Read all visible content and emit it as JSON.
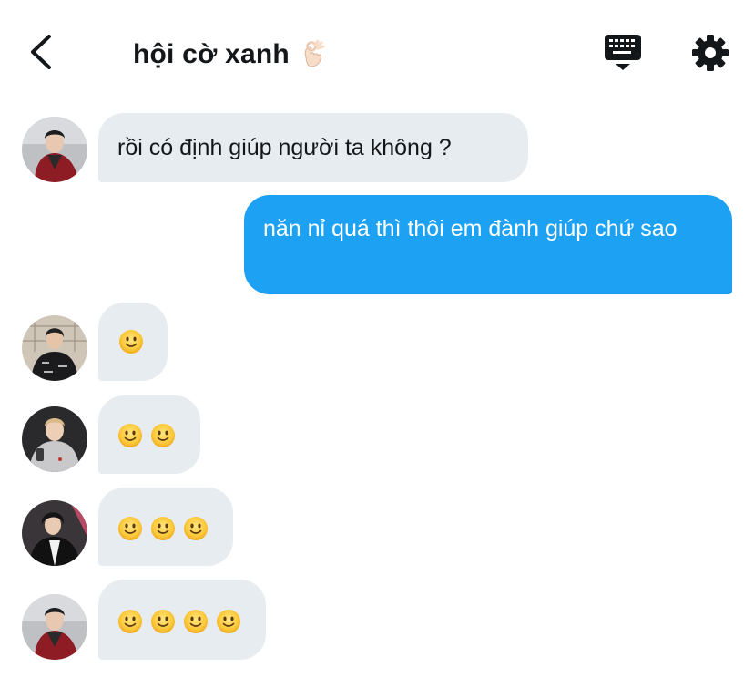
{
  "header": {
    "title": "hội cờ xanh",
    "title_emoji": "ok-hand-emoji",
    "back_icon": "chevron-left-icon",
    "keyboard_icon": "keyboard-icon",
    "settings_icon": "gear-icon"
  },
  "messages": [
    {
      "direction": "incoming",
      "text": "rồi có định giúp người ta không ?",
      "avatar": "avatar-red-jacket"
    },
    {
      "direction": "outgoing",
      "text": "năn nỉ quá thì thôi em đành giúp chứ sao"
    },
    {
      "direction": "incoming",
      "emoji_count": 1,
      "emoji": "slightly-smiling-face",
      "avatar": "avatar-black-jacket"
    },
    {
      "direction": "incoming",
      "emoji_count": 2,
      "emoji": "slightly-smiling-face",
      "avatar": "avatar-grey-hoodie"
    },
    {
      "direction": "incoming",
      "emoji_count": 3,
      "emoji": "slightly-smiling-face",
      "avatar": "avatar-dark-hair"
    },
    {
      "direction": "incoming",
      "emoji_count": 4,
      "emoji": "slightly-smiling-face",
      "avatar": "avatar-red-jacket"
    }
  ],
  "colors": {
    "incoming_bubble": "#e6ecf0",
    "outgoing_bubble": "#1da1f2",
    "text_dark": "#14171a"
  }
}
